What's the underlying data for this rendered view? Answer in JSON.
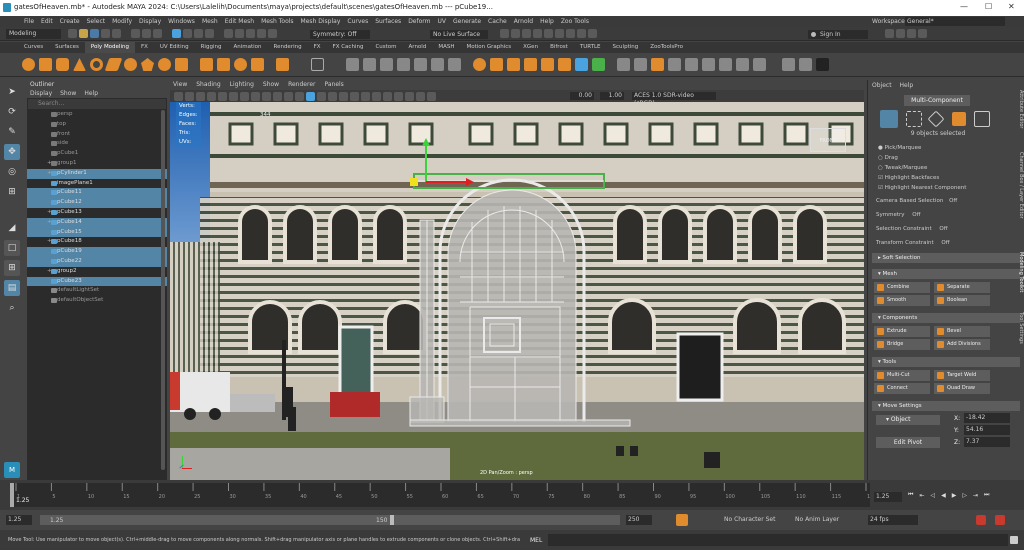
{
  "window": {
    "title": "gatesOfHeaven.mb* - Autodesk MAYA 2024: C:\\Users\\Lalelih\\Documents\\maya\\projects\\default\\scenes\\gatesOfHeaven.mb  ---  pCube19...",
    "min": "—",
    "max": "☐",
    "close": "✕"
  },
  "menu": [
    "File",
    "Edit",
    "Create",
    "Select",
    "Modify",
    "Display",
    "Windows",
    "Mesh",
    "Edit Mesh",
    "Mesh Tools",
    "Mesh Display",
    "Curves",
    "Surfaces",
    "Deform",
    "UV",
    "Generate",
    "Cache",
    "Arnold",
    "Help",
    "Zoo Tools"
  ],
  "workspace": {
    "label": "Workspace :",
    "value": "General*"
  },
  "status": {
    "mode": "Modeling",
    "symmetry": "Symmetry: Off",
    "live": "No Live Surface",
    "signin": "Sign In"
  },
  "shelf_tabs": [
    "Curves",
    "Surfaces",
    "Poly Modeling",
    "FX",
    "UV Editing",
    "Rigging",
    "Animation",
    "Rendering",
    "FX",
    "FX Caching",
    "Custom",
    "Arnold",
    "MASH",
    "Motion Graphics",
    "XGen",
    "Bifrost",
    "TURTLE",
    "Sculpting",
    "ZooToolsPro"
  ],
  "shelf_active": "Poly Modeling",
  "outliner": {
    "title": "Outliner",
    "menu": [
      "Display",
      "Show",
      "Help"
    ],
    "search": "Search...",
    "items": [
      {
        "name": "persp",
        "kind": "camera",
        "sel": false,
        "exp": ""
      },
      {
        "name": "top",
        "kind": "camera",
        "sel": false,
        "exp": ""
      },
      {
        "name": "front",
        "kind": "camera",
        "sel": false,
        "exp": ""
      },
      {
        "name": "side",
        "kind": "camera",
        "sel": false,
        "exp": ""
      },
      {
        "name": "pCube1",
        "kind": "camera",
        "sel": false,
        "exp": ""
      },
      {
        "name": "group1",
        "kind": "camera",
        "sel": false,
        "exp": "+"
      },
      {
        "name": "pCylinder1",
        "kind": "mesh",
        "sel": true,
        "exp": "+"
      },
      {
        "name": "imagePlane1",
        "kind": "mesh",
        "sel": false,
        "exp": ""
      },
      {
        "name": "pCube11",
        "kind": "mesh",
        "sel": true,
        "exp": ""
      },
      {
        "name": "pCube12",
        "kind": "mesh",
        "sel": true,
        "exp": ""
      },
      {
        "name": "pCube13",
        "kind": "mesh",
        "sel": false,
        "exp": "+"
      },
      {
        "name": "pCube14",
        "kind": "mesh",
        "sel": true,
        "exp": "+"
      },
      {
        "name": "pCube15",
        "kind": "mesh",
        "sel": true,
        "exp": ""
      },
      {
        "name": "pCube18",
        "kind": "mesh",
        "sel": false,
        "exp": "+"
      },
      {
        "name": "pCube19",
        "kind": "mesh",
        "sel": true,
        "exp": ""
      },
      {
        "name": "pCube22",
        "kind": "mesh",
        "sel": true,
        "exp": ""
      },
      {
        "name": "group2",
        "kind": "mesh",
        "sel": false,
        "exp": "+"
      },
      {
        "name": "pCube23",
        "kind": "mesh",
        "sel": true,
        "exp": ""
      },
      {
        "name": "defaultLightSet",
        "kind": "set",
        "sel": false,
        "exp": ""
      },
      {
        "name": "defaultObjectSet",
        "kind": "set",
        "sel": false,
        "exp": ""
      }
    ]
  },
  "viewport": {
    "menu": [
      "View",
      "Shading",
      "Lighting",
      "Show",
      "Renderer",
      "Panels"
    ],
    "val1": "0.00",
    "val2": "1.00",
    "colorspace": "ACES 1.0 SDR-video (sRGB)",
    "hud": [
      "Verts:",
      "Edges:",
      "Faces:",
      "Tris:",
      "UVs:"
    ],
    "hud_vals": [
      "",
      "344",
      "",
      "",
      ""
    ],
    "cam_label": "2D Pan/Zoom : persp",
    "front": "FRONT"
  },
  "channelbox": {
    "menu": [
      "Object",
      "Help"
    ],
    "mode": "Multi-Component",
    "count": "9 objects selected",
    "options": [
      {
        "label": "Pick/Marquee",
        "type": "radio"
      },
      {
        "label": "Drag",
        "type": "radio"
      },
      {
        "label": "Tweak/Marquee",
        "type": "radio"
      },
      {
        "label": "Highlight Backfaces",
        "type": "check"
      },
      {
        "label": "Highlight Nearest Component",
        "type": "check"
      }
    ],
    "camera_sel": "Camera Based Selection",
    "camera_sel_v": "Off",
    "symmetry": "Symmetry",
    "symmetry_v": "Off",
    "sel_constraint": "Selection Constraint",
    "sel_constraint_v": "Off",
    "transform_constraint": "Transform Constraint",
    "transform_constraint_v": "Off",
    "soft": "Soft Selection",
    "mesh": "Mesh",
    "combine": "Combine",
    "separate": "Separate",
    "smooth": "Smooth",
    "boolean": "Boolean",
    "components": "Components",
    "extrude": "Extrude",
    "bevel": "Bevel",
    "bridge": "Bridge",
    "add_div": "Add Divisions",
    "tools": "Tools",
    "multicut": "Multi-Cut",
    "target_weld": "Target Weld",
    "connect": "Connect",
    "quad_draw": "Quad Draw",
    "move": "Move Settings",
    "object": "Object",
    "edit_pivot": "Edit Pivot",
    "x_label": "X:",
    "x": "-18.42",
    "y_label": "Y:",
    "y": "54.16",
    "z_label": "Z:",
    "z": "7.37",
    "side_tabs": [
      "Attribute Editor",
      "Channel Box / Layer Editor",
      "Modeling Toolkit",
      "Tool Settings"
    ]
  },
  "timeline": {
    "ticks": [
      "1",
      "5",
      "10",
      "15",
      "20",
      "25",
      "30",
      "35",
      "40",
      "45",
      "50",
      "55",
      "60",
      "65",
      "70",
      "75",
      "80",
      "85",
      "90",
      "95",
      "100",
      "105",
      "110",
      "115",
      "120"
    ],
    "current": "1.25",
    "end_field": "1.25"
  },
  "range": {
    "start": "1.25",
    "inner_start": "1.25",
    "inner_end": "150",
    "end": "250",
    "char_set": "No Character Set",
    "anim_layer": "No Anim Layer",
    "fps": "24 fps"
  },
  "cmd": {
    "help": "Move Tool: Use manipulator to move object(s). Ctrl+middle-drag to move components along normals. Shift+drag manipulator axis or plane handles to extrude components or clone objects. Ctrl+Shift+drag to cons",
    "lang": "MEL"
  },
  "colors": {
    "selection": "#5285a6",
    "accent": "#e08b2e",
    "active_icon": "#4aa3df"
  }
}
